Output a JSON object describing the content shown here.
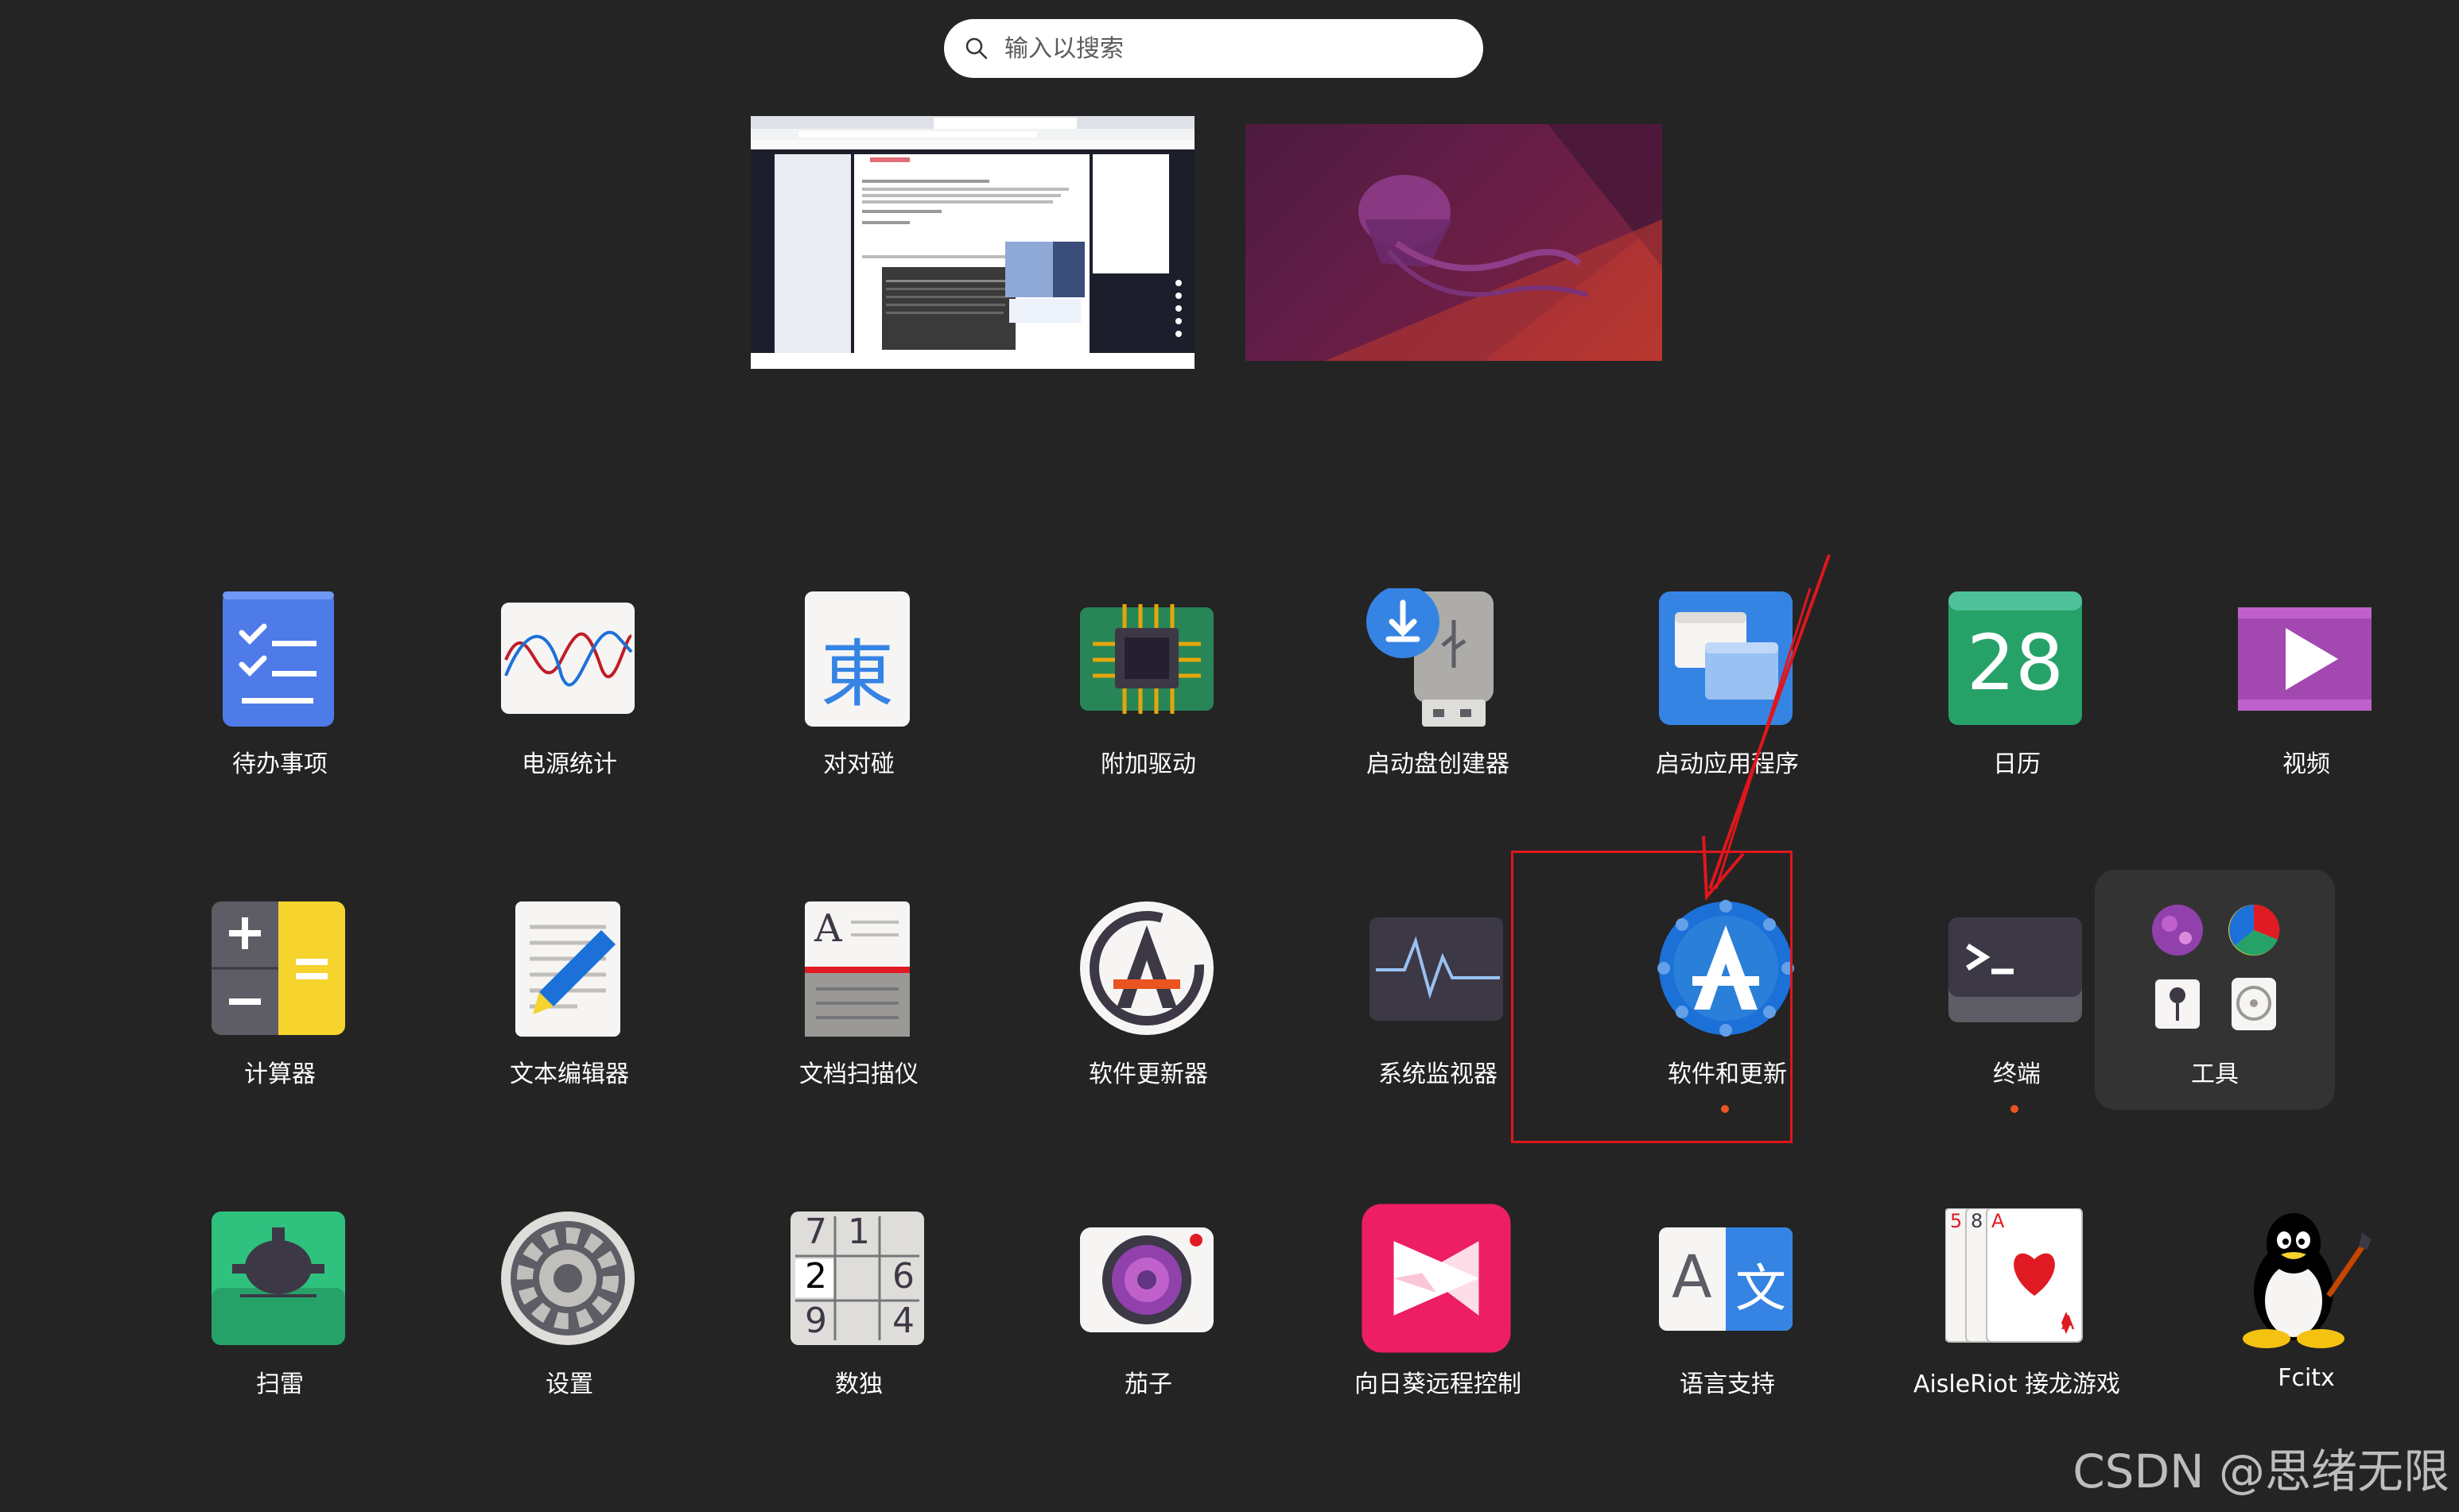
{
  "search": {
    "placeholder": "输入以搜索"
  },
  "apps_row1": [
    {
      "label": "待办事项"
    },
    {
      "label": "电源统计"
    },
    {
      "label": "对对碰",
      "glyph": "東"
    },
    {
      "label": "附加驱动"
    },
    {
      "label": "启动盘创建器"
    },
    {
      "label": "启动应用程序"
    },
    {
      "label": "日历",
      "glyph": "28"
    },
    {
      "label": "视频"
    }
  ],
  "apps_row2": [
    {
      "label": "计算器"
    },
    {
      "label": "文本编辑器"
    },
    {
      "label": "文档扫描仪"
    },
    {
      "label": "软件更新器"
    },
    {
      "label": "系统监视器"
    },
    {
      "label": "软件和更新",
      "running": true
    },
    {
      "label": "终端",
      "running": true
    },
    {
      "label": "工具",
      "is_folder": true
    }
  ],
  "apps_row3": [
    {
      "label": "扫雷"
    },
    {
      "label": "设置"
    },
    {
      "label": "数独",
      "glyphs": [
        "7",
        "1",
        "2",
        "6",
        "9",
        "4"
      ]
    },
    {
      "label": "茄子"
    },
    {
      "label": "向日葵远程控制"
    },
    {
      "label": "语言支持",
      "glyphs": [
        "A",
        "文"
      ]
    },
    {
      "label": "AisleRiot 接龙游戏",
      "glyphs": [
        "5",
        "8",
        "A",
        "A"
      ]
    },
    {
      "label": "Fcitx"
    }
  ],
  "watermark": "CSDN @思绪无限",
  "colors": {
    "background": "#242424",
    "highlight": "#e0161c",
    "running_dot": "#e95420"
  }
}
